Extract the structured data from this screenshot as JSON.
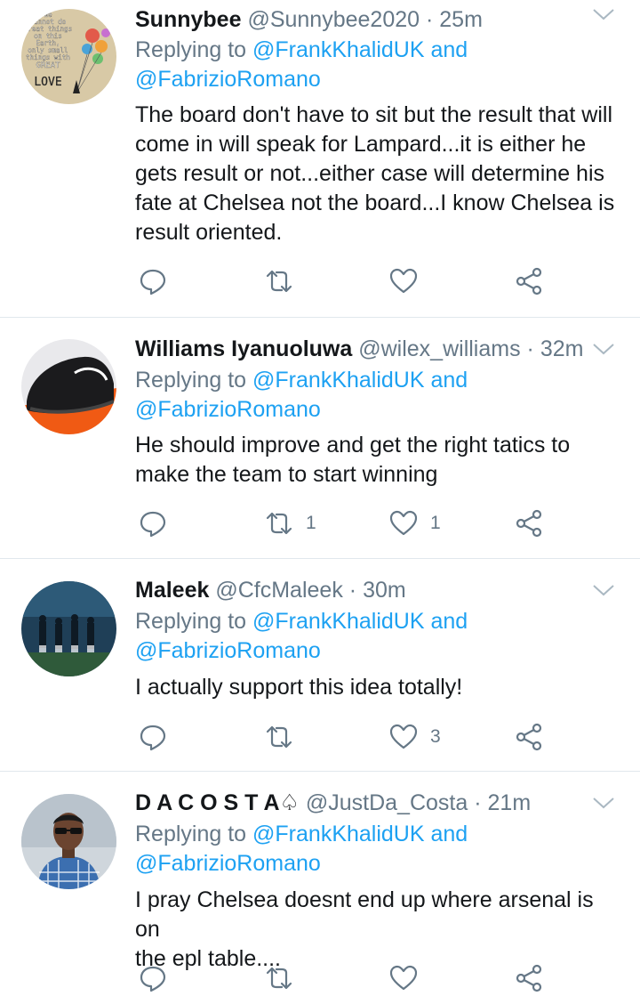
{
  "tweets": [
    {
      "name": "Sunnybee",
      "handle": "@Sunnybee2020",
      "separator": "·",
      "time": "25m",
      "replying_prefix": "Replying to",
      "replying_mentions": "@FrankKhalidUK and",
      "replying_mentions_2": "@FabrizioRomano",
      "text_lines": [
        "The board don't have to sit but the result that will",
        "come in will speak for Lampard...it is either he",
        "gets result or not...either case will determine his",
        "fate at Chelsea not the board...I know Chelsea is",
        "result oriented."
      ],
      "avatar_text": [
        "We",
        "cannot do",
        "great things",
        "on this",
        "Earth,",
        "only small",
        "things with",
        "GREAT",
        "LOVE"
      ],
      "retweets": "",
      "likes": ""
    },
    {
      "name": "Williams Iyanuoluwa",
      "handle": "@wilex_williams",
      "separator": "·",
      "time": "32m",
      "replying_prefix": "Replying to",
      "replying_mentions": "@FrankKhalidUK and",
      "replying_mentions_2": "@FabrizioRomano",
      "text_lines": [
        "He should improve and get the right tatics to",
        "make the team to start winning"
      ],
      "retweets": "1",
      "likes": "1"
    },
    {
      "name": "Maleek",
      "handle": "@CfcMaleek",
      "separator": "·",
      "time": "30m",
      "replying_prefix": "Replying to",
      "replying_mentions": "@FrankKhalidUK and",
      "replying_mentions_2": "@FabrizioRomano",
      "text_lines": [
        "I actually support this idea totally!"
      ],
      "retweets": "",
      "likes": "3"
    },
    {
      "name": "D A C O S T A",
      "name_emoji": "♤",
      "handle": "@JustDa_Costa",
      "separator": "·",
      "time": "21m",
      "replying_prefix": "Replying to",
      "replying_mentions": "@FrankKhalidUK and",
      "replying_mentions_2": "@FabrizioRomano",
      "text_lines": [
        "I pray Chelsea doesnt end up where arsenal is on",
        "the epl table...."
      ],
      "retweets": "",
      "likes": ""
    }
  ],
  "icons": {
    "reply": "reply-bubble-icon",
    "retweet": "retweet-icon",
    "like": "heart-icon",
    "share": "share-icon",
    "menu": "chevron-down-icon"
  },
  "colors": {
    "link": "#1da1f2",
    "muted": "#657786",
    "text": "#14171a",
    "divider": "#e1e8ed"
  }
}
